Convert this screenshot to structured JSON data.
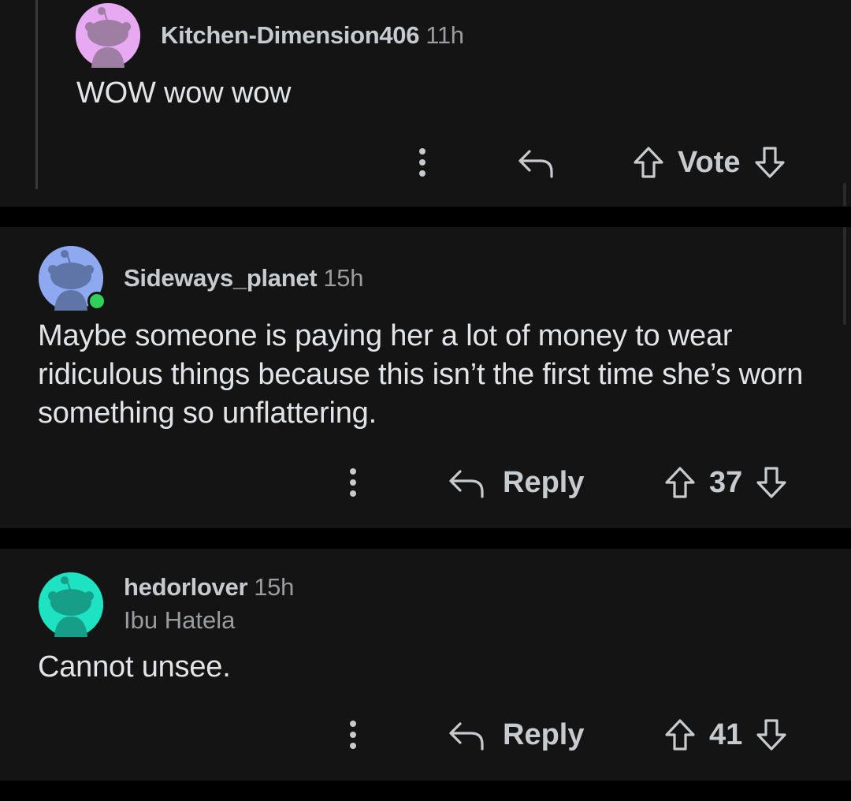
{
  "colors": {
    "background": "#000000",
    "card": "#141415",
    "text_primary": "#e2e4e6",
    "text_secondary": "#9a9c9e",
    "online": "#2fd15b"
  },
  "comments": [
    {
      "username": "Kitchen-Dimension406",
      "time": "11h",
      "body": "WOW wow wow",
      "avatar_color": "#e7a9f2",
      "avatar_icon": "snoo-avatar-icon",
      "online": false,
      "actions": {
        "more_icon": "more-vertical-icon",
        "reply_icon": "reply-arrow-icon",
        "reply_label": "",
        "upvote_icon": "arrow-up-icon",
        "vote_label": "Vote",
        "downvote_icon": "arrow-down-icon"
      }
    },
    {
      "username": "Sideways_planet",
      "time": "15h",
      "body": "Maybe someone is paying her a lot of money to wear ridiculous things because this isn’t the first time she’s worn something so unflattering.",
      "avatar_color": "#8fa9f0",
      "avatar_icon": "snoo-avatar-icon",
      "online": true,
      "actions": {
        "more_icon": "more-vertical-icon",
        "reply_icon": "reply-arrow-icon",
        "reply_label": "Reply",
        "upvote_icon": "arrow-up-icon",
        "vote_label": "37",
        "downvote_icon": "arrow-down-icon"
      }
    },
    {
      "username": "hedorlover",
      "time": "15h",
      "flair": "Ibu Hatela",
      "body": "Cannot unsee.",
      "avatar_color": "#1ee3c2",
      "avatar_icon": "snoo-avatar-icon",
      "online": false,
      "actions": {
        "more_icon": "more-vertical-icon",
        "reply_icon": "reply-arrow-icon",
        "reply_label": "Reply",
        "upvote_icon": "arrow-up-icon",
        "vote_label": "41",
        "downvote_icon": "arrow-down-icon"
      }
    }
  ]
}
